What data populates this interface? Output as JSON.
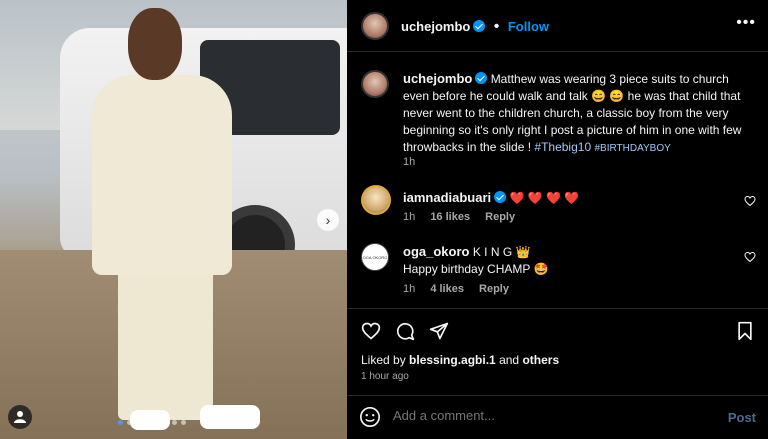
{
  "post": {
    "image_alt": "Boy in white three-piece suit standing in front of white SUV",
    "carousel_dots": 8,
    "active_dot": 0
  },
  "header": {
    "username": "uchejombo",
    "follow_label": "Follow",
    "more_icon": "more-horizontal-icon"
  },
  "caption": {
    "username": "uchejombo",
    "text": "Matthew was wearing 3 piece suits to church even before he could walk and talk 😄 😄  he was that child that never went to the children church, a classic boy from the very beginning so it's only right I post a picture of him in one with few throwbacks in the slide ! ",
    "hashtag1": "#Thebig10",
    "hashtag2": "#BIRTHDAYBOY",
    "time": "1h"
  },
  "comments": [
    {
      "username": "iamnadiabuari",
      "text": "❤️ ❤️ ❤️ ❤️",
      "time": "1h",
      "likes": "16 likes",
      "reply": "Reply"
    },
    {
      "username": "oga_okoro",
      "badge": "K I N G 👑",
      "text": "Happy birthday CHAMP 🤩",
      "time": "1h",
      "likes": "4 likes",
      "reply": "Reply",
      "avatar_text": "OGA OKORO"
    }
  ],
  "likes_line": {
    "prefix": "Liked by ",
    "user": "blessing.agbi.1",
    "suffix": " and ",
    "others": "others"
  },
  "posted_ago": "1 hour ago",
  "add_comment": {
    "placeholder": "Add a comment...",
    "post_label": "Post"
  },
  "colors": {
    "accent": "#0095f6",
    "hashtag": "#a4c7f5",
    "muted": "#a8a8a8",
    "heart": "#ed4956"
  }
}
